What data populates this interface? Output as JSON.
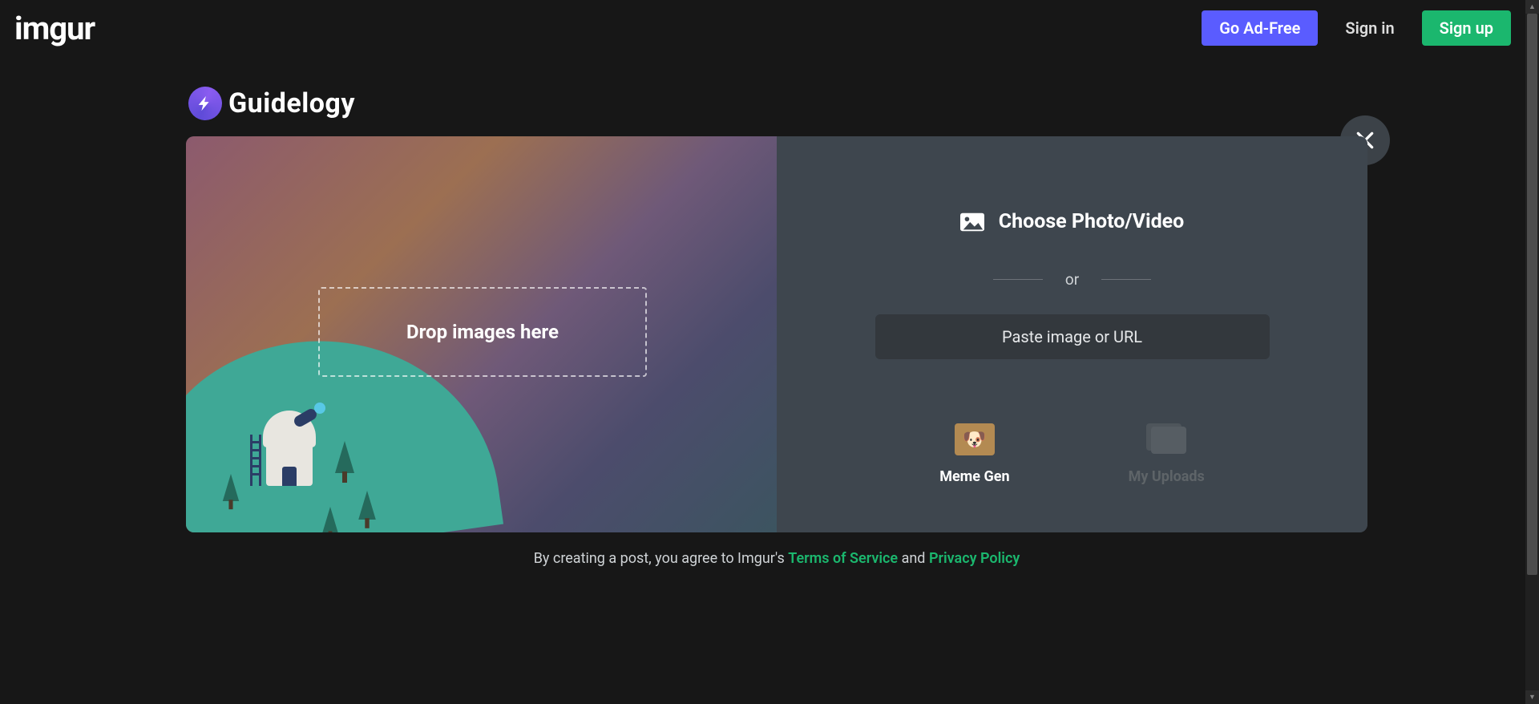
{
  "header": {
    "logo_text": "imgur",
    "go_ad_free": "Go Ad-Free",
    "sign_in": "Sign in",
    "sign_up": "Sign up"
  },
  "badge": {
    "name": "Guidelogy"
  },
  "upload": {
    "drop_text": "Drop images here",
    "choose_label": "Choose Photo/Video",
    "or_label": "or",
    "paste_placeholder": "Paste image or URL",
    "meme_gen": "Meme Gen",
    "my_uploads": "My Uploads"
  },
  "legal": {
    "prefix": "By creating a post, you agree to Imgur's",
    "terms": "Terms of Service",
    "and": "and",
    "privacy": "Privacy Policy"
  },
  "colors": {
    "accent_green": "#1bb76e",
    "accent_purple": "#5a5cff",
    "panel": "#3e464e",
    "bg": "#171717"
  }
}
